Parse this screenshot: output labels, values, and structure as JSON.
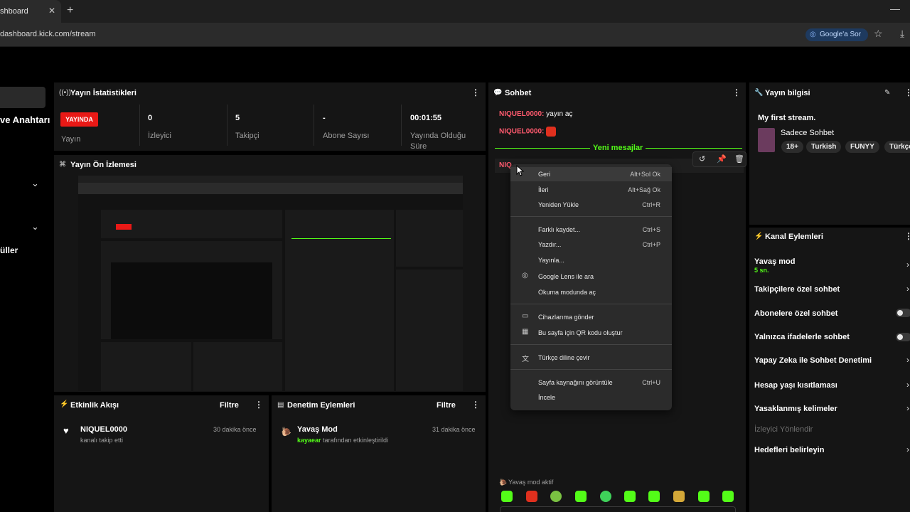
{
  "browser": {
    "tab_title": "shboard",
    "url": "dashboard.kick.com/stream",
    "google_label": "Google'a Sor"
  },
  "nav": {
    "keys_label": "ve Anahtarı",
    "uller_label": "üller"
  },
  "stats": {
    "title": "Yayın İstatistikleri",
    "live_badge": "YAYINDA",
    "stream_label": "Yayın",
    "viewers_value": "0",
    "viewers_label": "İzleyici",
    "followers_value": "5",
    "followers_label": "Takipçi",
    "subs_value": "-",
    "subs_label": "Abone Sayısı",
    "time_value": "00:01:55",
    "time_label": "Yayında Olduğu Süre"
  },
  "preview": {
    "title": "Yayın Ön İzlemesi"
  },
  "chat": {
    "title": "Sohbet",
    "messages": [
      {
        "user": "NIQUEL0000",
        "text": " yayın aç"
      },
      {
        "user": "NIQUEL0000",
        "text": ""
      }
    ],
    "new_messages_label": "Yeni mesajlar",
    "partial_user": "NIQ",
    "slow_mode_status": "Yavaş mod aktif"
  },
  "context_menu": {
    "items": [
      {
        "label": "Geri",
        "shortcut": "Alt+Sol Ok"
      },
      {
        "label": "İleri",
        "shortcut": "Alt+Sağ Ok"
      },
      {
        "label": "Yeniden Yükle",
        "shortcut": "Ctrl+R"
      },
      {
        "label": "Farklı kaydet...",
        "shortcut": "Ctrl+S"
      },
      {
        "label": "Yazdır...",
        "shortcut": "Ctrl+P"
      },
      {
        "label": "Yayınla...",
        "shortcut": ""
      },
      {
        "label": "Google Lens ile ara",
        "shortcut": ""
      },
      {
        "label": "Okuma modunda aç",
        "shortcut": ""
      },
      {
        "label": "Cihazlarıma gönder",
        "shortcut": ""
      },
      {
        "label": "Bu sayfa için QR kodu oluştur",
        "shortcut": ""
      },
      {
        "label": "Türkçe diline çevir",
        "shortcut": ""
      },
      {
        "label": "Sayfa kaynağını görüntüle",
        "shortcut": "Ctrl+U"
      },
      {
        "label": "İncele",
        "shortcut": ""
      }
    ]
  },
  "stream_info": {
    "title": "Yayın bilgisi",
    "stream_title": "My first stream.",
    "category": "Sadece Sohbet",
    "tags": [
      "18+",
      "Turkish",
      "FUNYY",
      "Türkçe"
    ]
  },
  "channel_actions": {
    "title": "Kanal Eylemleri",
    "slow_mode": "Yavaş mod",
    "slow_mode_value": "5 sn.",
    "followers_only": "Takipçilere özel sohbet",
    "subs_only": "Abonelere özel sohbet",
    "emotes_only": "Yalnızca ifadelerle sohbet",
    "ai_moderation": "Yapay Zeka ile Sohbet Denetimi",
    "account_age": "Hesap yaşı kısıtlaması",
    "banned_words": "Yasaklanmış kelimeler",
    "viewer_redirect": "İzleyici Yönlendir",
    "set_goals": "Hedefleri belirleyin"
  },
  "activity": {
    "title": "Etkinlik Akışı",
    "filter": "Filtre",
    "user": "NIQUEL0000",
    "action": "kanalı takip etti",
    "time": "30 dakika önce"
  },
  "moderation": {
    "title": "Denetim Eylemleri",
    "filter": "Filtre",
    "event": "Yavaş Mod",
    "actor": "kayaear",
    "action": " tarafından etkinleştirildi",
    "time": "31 dakika önce"
  },
  "colors": {
    "kick_green": "#53fc18",
    "live_red": "#e91916",
    "chat_user": "#ff5a6e"
  }
}
